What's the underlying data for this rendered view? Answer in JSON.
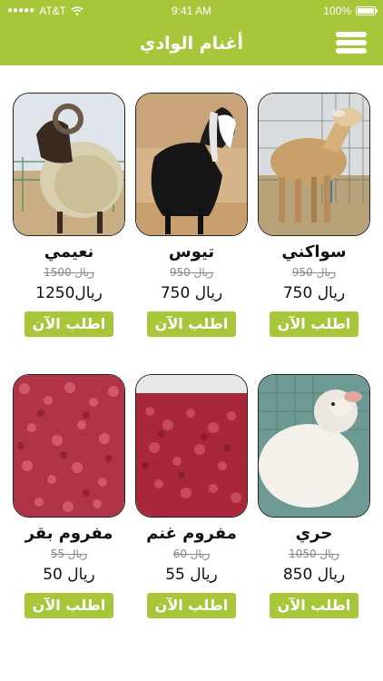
{
  "status_bar": {
    "carrier": "AT&T",
    "time": "9:41 AM",
    "battery": "100%"
  },
  "header": {
    "title": "أغنام الوادي",
    "menu_icon": "hamburger-icon"
  },
  "colors": {
    "accent": "#a7c63a"
  },
  "products": [
    {
      "name": "سواكني",
      "old_price": "950 ريال",
      "price": "750 ريال",
      "order_label": "اطلب الآن"
    },
    {
      "name": "تيوس",
      "old_price": "950 ريال",
      "price": "750 ريال",
      "order_label": "اطلب الآن"
    },
    {
      "name": "نعيمي",
      "old_price": "1500 ريال",
      "price": "1250ريال",
      "order_label": "اطلب الآن"
    },
    {
      "name": "حري",
      "old_price": "1050 ريال",
      "price": "850 ريال",
      "order_label": "اطلب الآن"
    },
    {
      "name": "مفروم غنم",
      "old_price": "60 ريال",
      "price": "55 ريال",
      "order_label": "اطلب الآن"
    },
    {
      "name": "مفروم بقر",
      "old_price": "55 ريال",
      "price": "50 ريال",
      "order_label": "اطلب الآن"
    }
  ]
}
